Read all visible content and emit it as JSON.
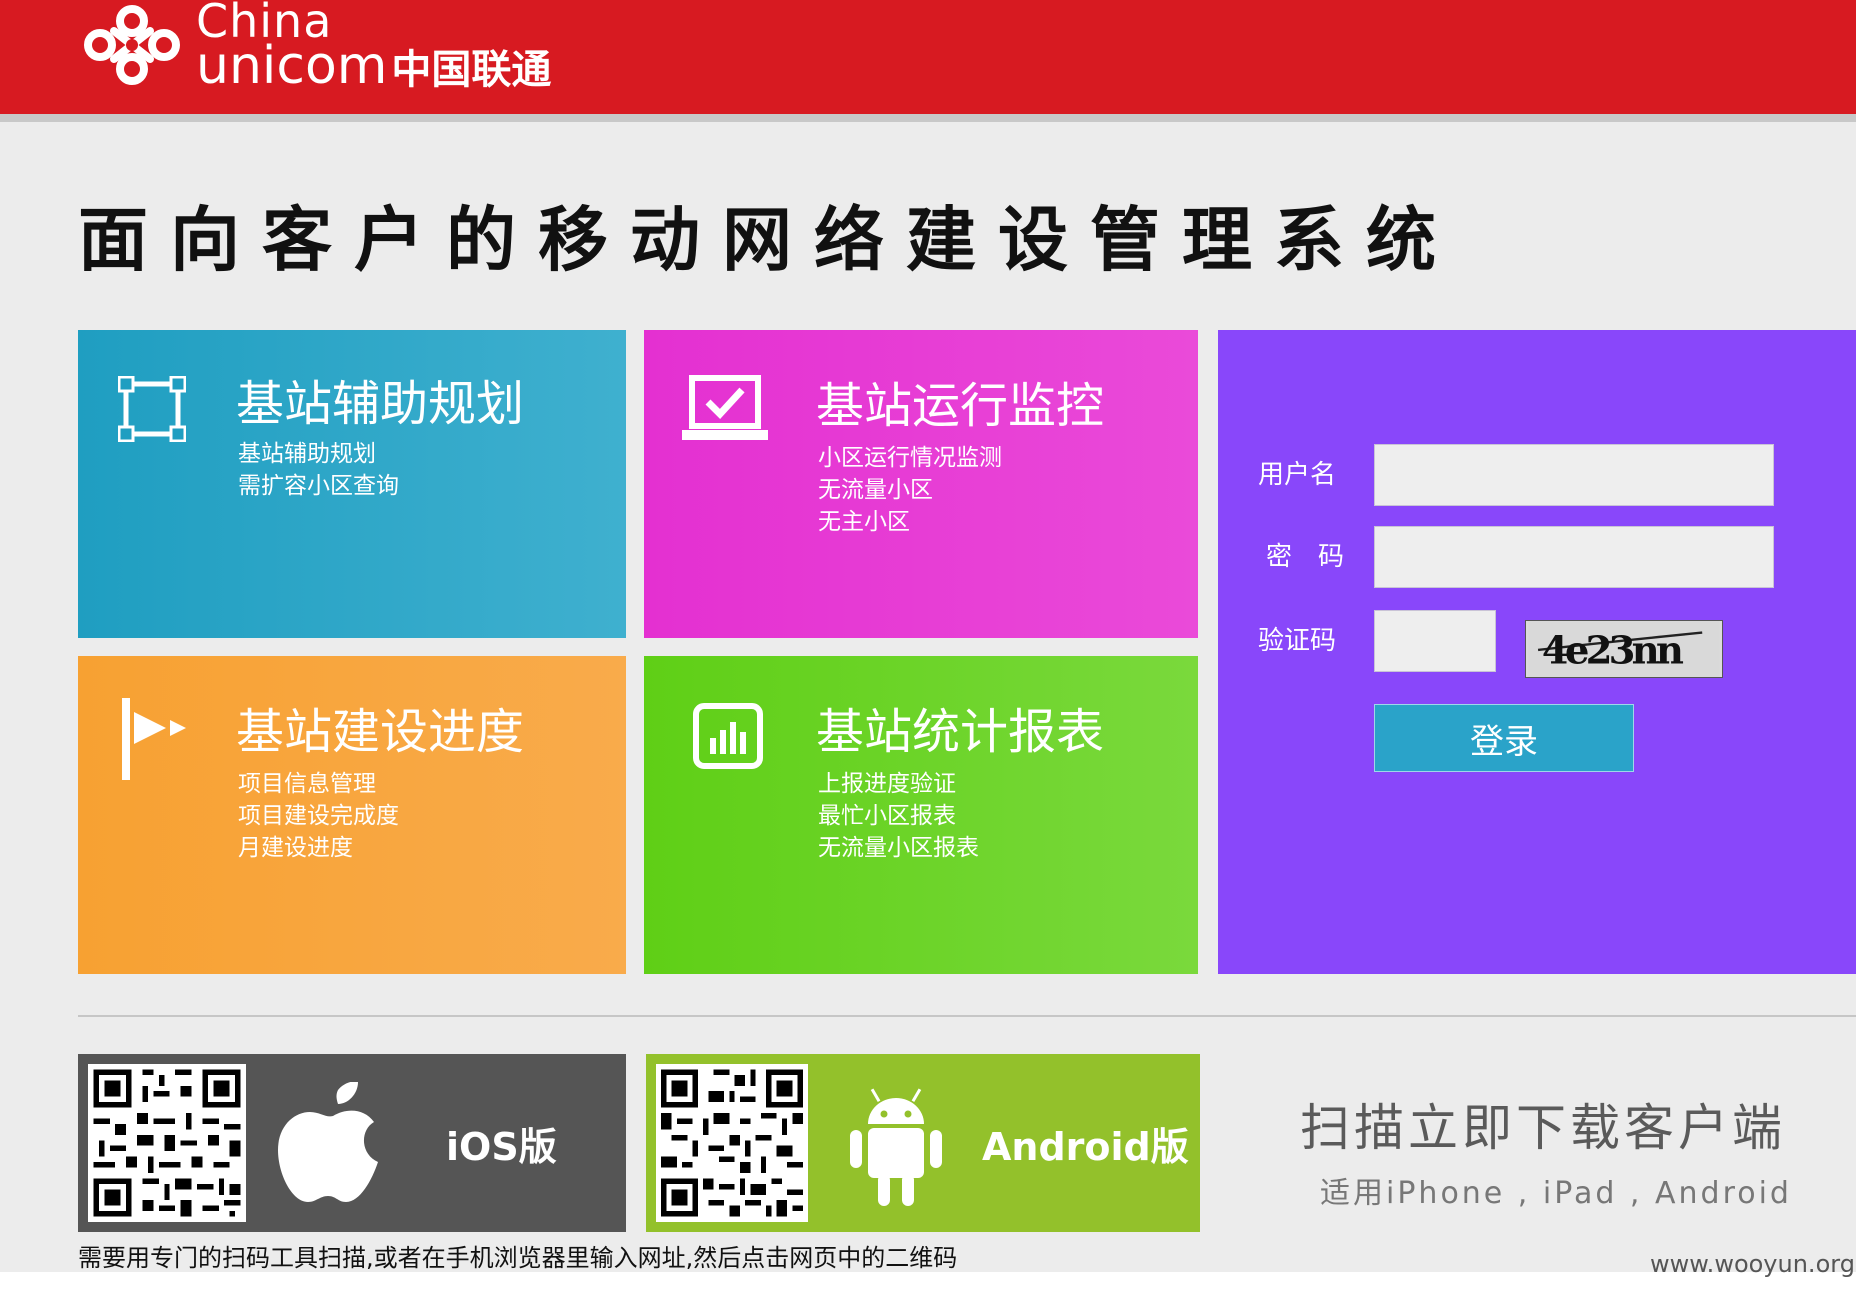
{
  "header": {
    "logo_en_line1": "China",
    "logo_en_line2": "unicom",
    "logo_cn": "中国联通",
    "bg_color": "#d71a21"
  },
  "page_title": "面向客户的移动网络建设管理系统",
  "tiles": [
    {
      "title": "基站辅助规划",
      "icon": "selection-frame-icon",
      "color": "#1f9ec1",
      "items": [
        "基站辅助规划",
        "需扩容小区查询"
      ]
    },
    {
      "title": "基站运行监控",
      "icon": "laptop-check-icon",
      "color": "#e430d1",
      "items": [
        "小区运行情况监测",
        "无流量小区",
        "无主小区"
      ]
    },
    {
      "title": "基站建设进度",
      "icon": "flag-progress-icon",
      "color": "#f7a132",
      "items": [
        "项目信息管理",
        "项目建设完成度",
        "月建设进度"
      ]
    },
    {
      "title": "基站统计报表",
      "icon": "bar-chart-icon",
      "color": "#5fcf16",
      "items": [
        "上报进度验证",
        "最忙小区报表",
        "无流量小区报表"
      ]
    }
  ],
  "login": {
    "bg_color": "#8947fa",
    "username_label": "用户名",
    "username_value": "",
    "password_label": "密　码",
    "password_value": "",
    "captcha_label": "验证码",
    "captcha_value": "",
    "captcha_text": "4e23nn",
    "submit_label": "登录"
  },
  "downloads": {
    "ios_label": "iOS版",
    "android_label": "Android版",
    "scan_title": "扫描立即下载客户端",
    "scan_subtitle": "适用iPhone , iPad , Android",
    "note": "需要用专门的扫码工具扫描,或者在手机浏览器里输入网址,然后点击网页中的二维码"
  },
  "watermark": "www.wooyun.org"
}
